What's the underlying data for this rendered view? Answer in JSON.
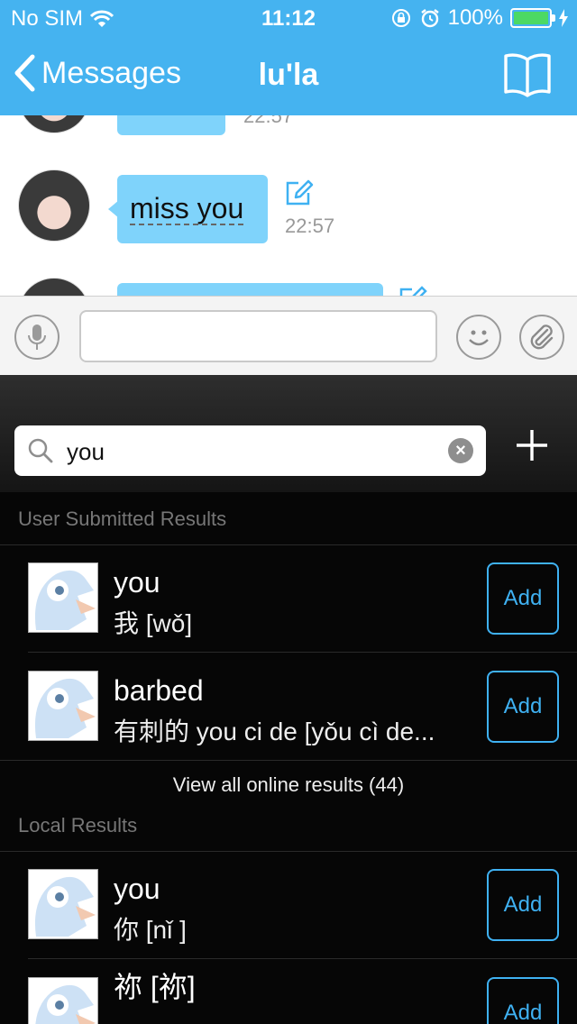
{
  "status": {
    "carrier": "No SIM",
    "time": "11:12",
    "battery": "100%"
  },
  "nav": {
    "back_label": "Messages",
    "title": "lu'la"
  },
  "chat": {
    "prev_time": "22:57",
    "message": {
      "text": "miss you",
      "time": "22:57"
    }
  },
  "search": {
    "value": "you"
  },
  "results": {
    "user_header": "User Submitted Results",
    "user_items": [
      {
        "word": "you",
        "definition": "我 [wǒ]",
        "action": "Add"
      },
      {
        "word": "barbed",
        "definition": "有刺的 you ci de [yǒu cì de...",
        "action": "Add"
      }
    ],
    "view_all": "View all online results (44)",
    "local_header": "Local Results",
    "local_items": [
      {
        "word": "you",
        "definition": "你 [nǐ ]",
        "action": "Add"
      },
      {
        "word": "祢 [祢]",
        "definition": "",
        "action": "Add"
      }
    ]
  },
  "colors": {
    "accent": "#45b3f0",
    "bubble": "#7fd3fb",
    "add_button": "#3fb1f2"
  }
}
